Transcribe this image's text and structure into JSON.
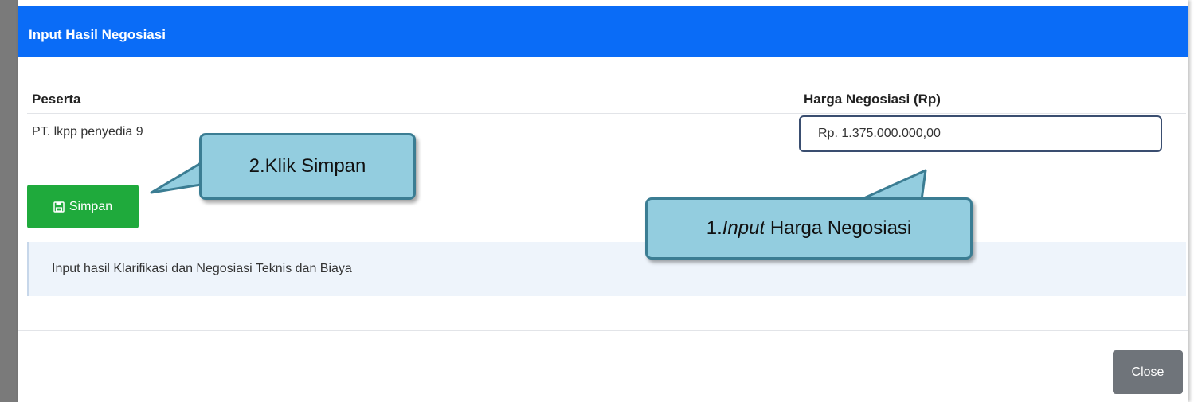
{
  "dialog": {
    "title": "Input Hasil Negosiasi"
  },
  "table": {
    "columns": [
      "Peserta",
      "Harga Negosiasi (Rp)"
    ],
    "rows": [
      {
        "peserta": "PT. lkpp penyedia 9",
        "harga": "Rp. 1.375.000.000,00"
      }
    ]
  },
  "actions": {
    "save_label": "Simpan",
    "save_icon": "floppy-disk-icon",
    "close_label": "Close"
  },
  "info": {
    "text": "Input hasil Klarifikasi dan Negosiasi Teknis dan Biaya"
  },
  "annotations": {
    "step1_number": "1.",
    "step1_emphasis": "Input",
    "step1_rest": " Harga Negosiasi",
    "step2": "2.Klik Simpan"
  },
  "colors": {
    "header": "#0a6cf7",
    "save_button": "#1faa3c",
    "close_button": "#6f747a",
    "callout_fill": "#93cddf",
    "callout_border": "#3b7d93"
  }
}
